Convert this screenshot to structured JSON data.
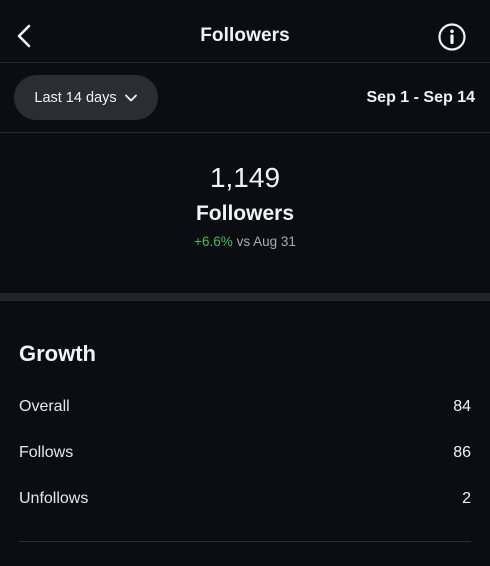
{
  "header": {
    "title": "Followers",
    "back_icon": "chevron-left-icon",
    "info_icon": "info-circle-icon"
  },
  "filter": {
    "range_label": "Last 14 days",
    "range_icon": "chevron-down-icon",
    "date_range": "Sep 1 - Sep 14"
  },
  "summary": {
    "count": "1,149",
    "label": "Followers",
    "change": "+6.6%",
    "comparison": "vs Aug 31"
  },
  "growth": {
    "title": "Growth",
    "rows": [
      {
        "label": "Overall",
        "value": "84"
      },
      {
        "label": "Follows",
        "value": "86"
      },
      {
        "label": "Unfollows",
        "value": "2"
      }
    ]
  },
  "colors": {
    "background": "#0b0d12",
    "positive": "#3fbe5b",
    "pill": "#2a2d33"
  }
}
